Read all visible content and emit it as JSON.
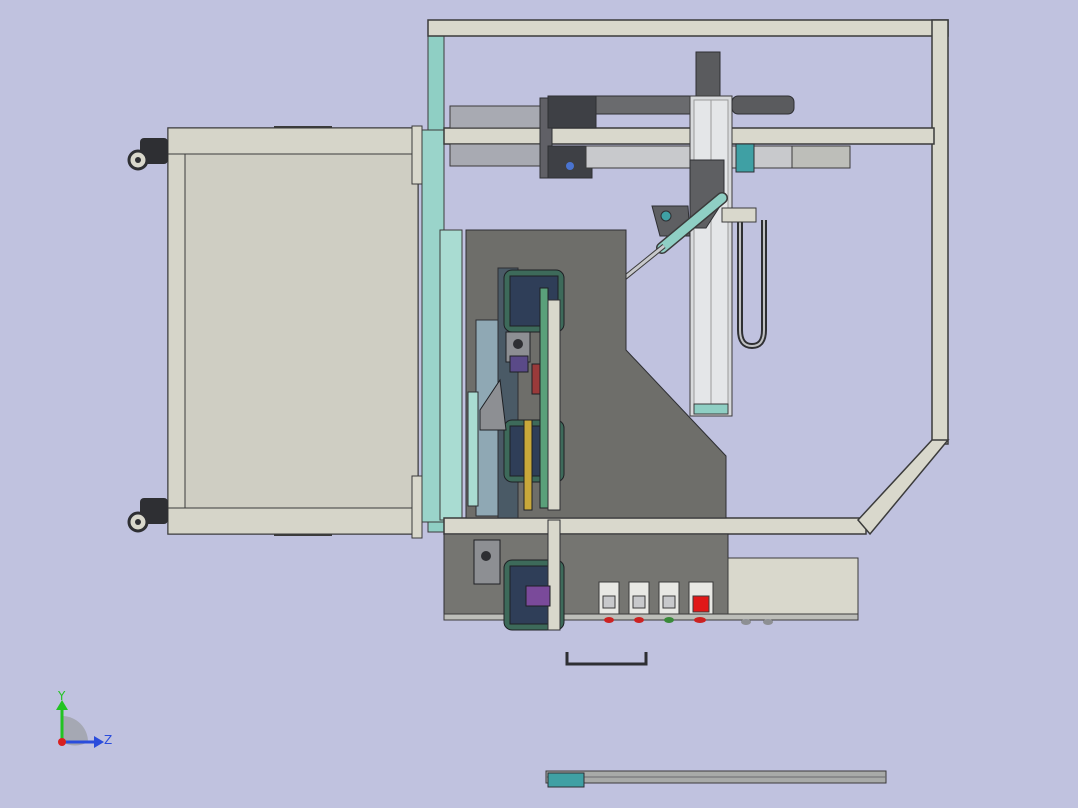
{
  "viewport": {
    "background": "#c0c2df",
    "triad": {
      "y_label": "Y",
      "z_label": "Z"
    }
  },
  "colors": {
    "frame": "#d9d8cc",
    "frame_stroke": "#3b3b3b",
    "teal": "#8fcfc4",
    "plate": "#6e6e6a",
    "gray_part": "#a8aaa8",
    "dark": "#2e2f33",
    "red_button": "#e01818",
    "axis_y": "#22c322",
    "axis_z": "#2a4cdc",
    "axis_x": "#d82020"
  },
  "components": {
    "cart": "cart-frame-icon",
    "casters": "caster-wheel-icon",
    "gantry": "gantry-axis-icon",
    "dispenser": "dispense-needle-icon",
    "fixtures": "rotary-fixture-icon",
    "control_panel": "control-button-icon",
    "handle": "handle-icon",
    "rail": "linear-rail-icon",
    "triad": "coordinate-triad-icon"
  }
}
